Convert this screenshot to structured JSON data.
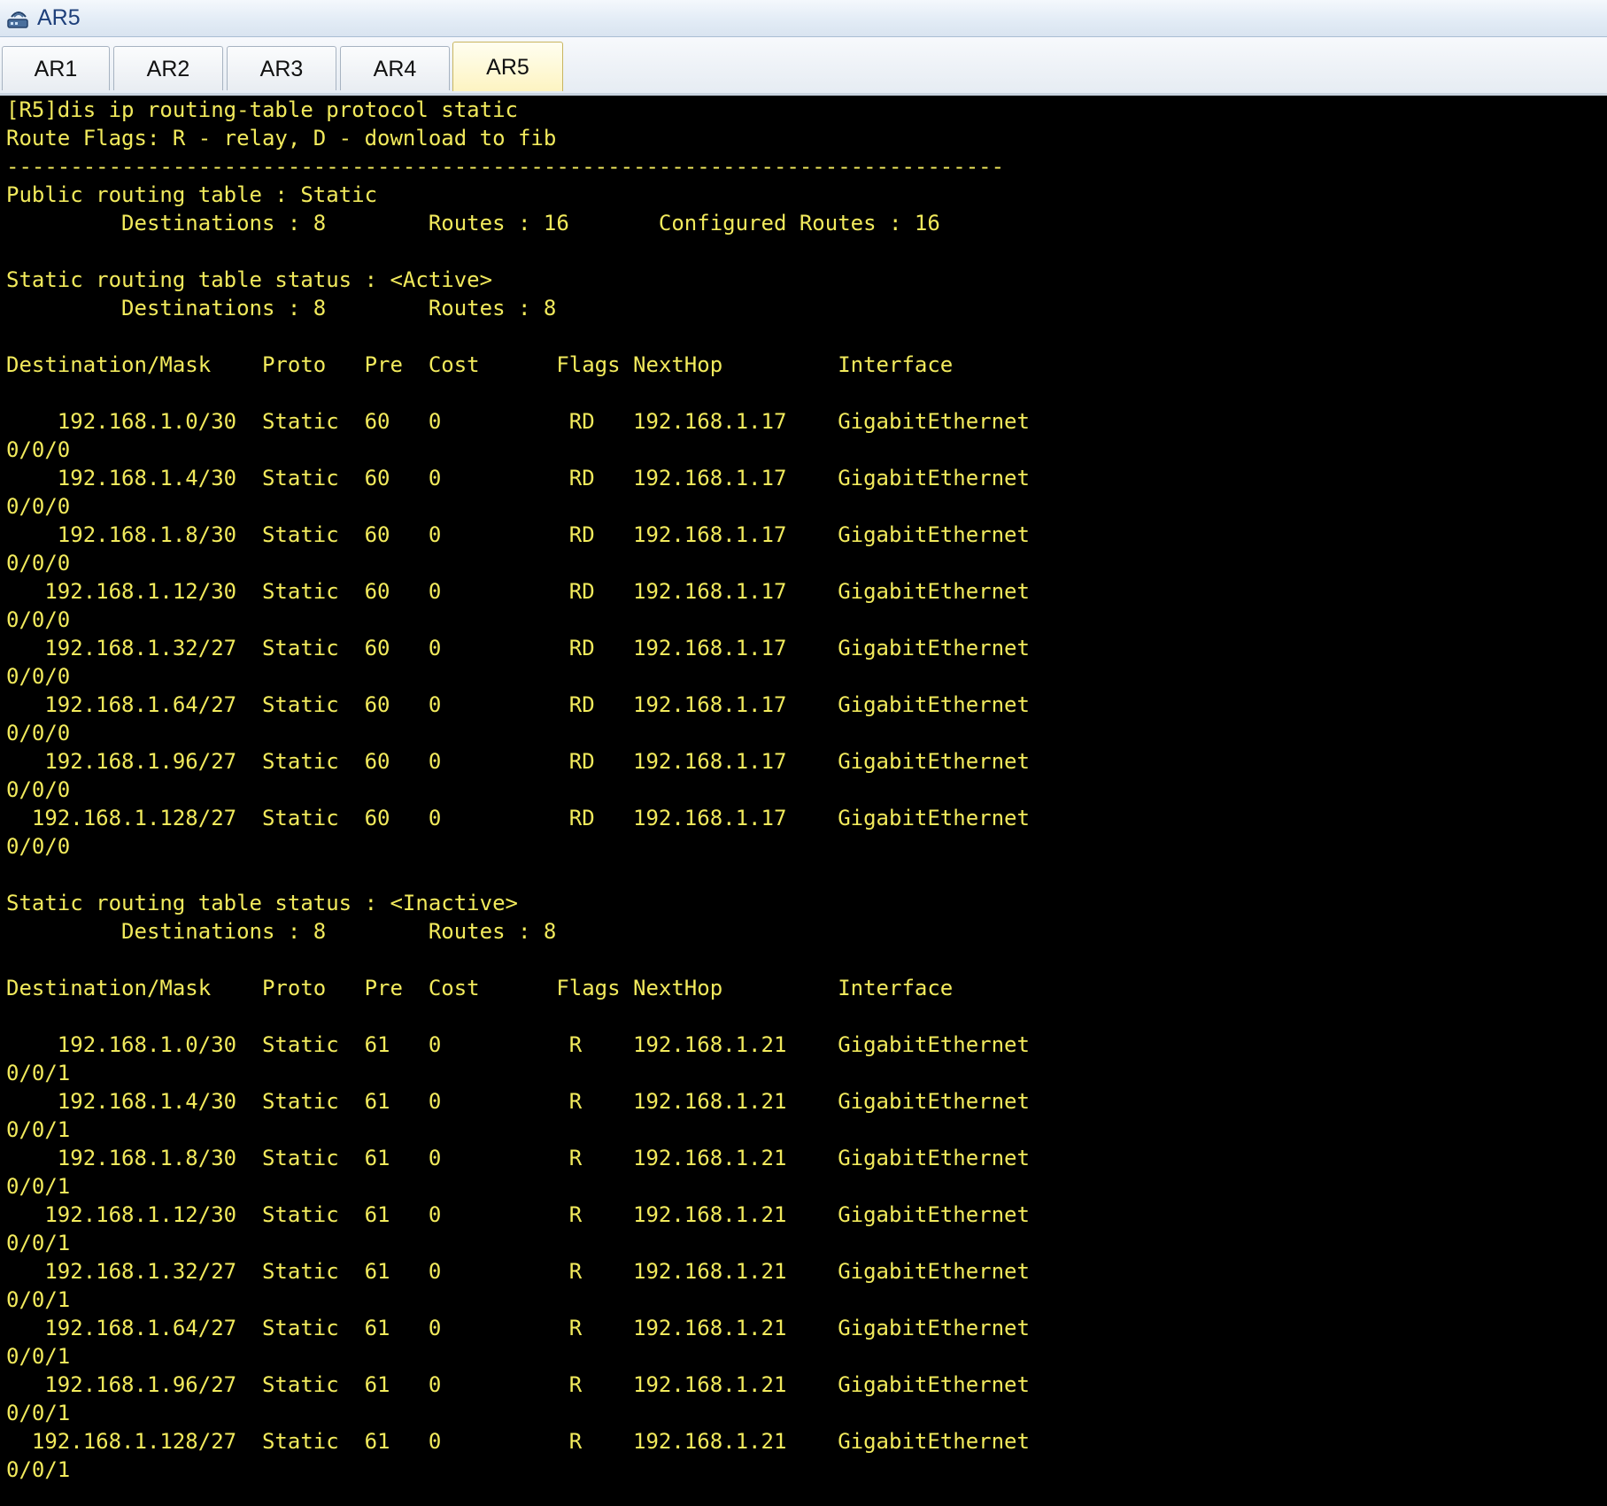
{
  "window": {
    "title": "AR5",
    "icon": "router-app-icon"
  },
  "tabs": [
    {
      "label": "AR1",
      "active": false
    },
    {
      "label": "AR2",
      "active": false
    },
    {
      "label": "AR3",
      "active": false
    },
    {
      "label": "AR4",
      "active": false
    },
    {
      "label": "AR5",
      "active": true
    }
  ],
  "console": {
    "text_color": "#f2ea5c",
    "background_color": "#000000",
    "lines": [
      "[R5]dis ip routing-table protocol static",
      "Route Flags: R - relay, D - download to fib",
      "------------------------------------------------------------------------------",
      "Public routing table : Static",
      "         Destinations : 8        Routes : 16       Configured Routes : 16",
      "",
      "Static routing table status : <Active>",
      "         Destinations : 8        Routes : 8",
      "",
      "Destination/Mask    Proto   Pre  Cost      Flags NextHop         Interface",
      "",
      "    192.168.1.0/30  Static  60   0          RD   192.168.1.17    GigabitEthernet",
      "0/0/0",
      "    192.168.1.4/30  Static  60   0          RD   192.168.1.17    GigabitEthernet",
      "0/0/0",
      "    192.168.1.8/30  Static  60   0          RD   192.168.1.17    GigabitEthernet",
      "0/0/0",
      "   192.168.1.12/30  Static  60   0          RD   192.168.1.17    GigabitEthernet",
      "0/0/0",
      "   192.168.1.32/27  Static  60   0          RD   192.168.1.17    GigabitEthernet",
      "0/0/0",
      "   192.168.1.64/27  Static  60   0          RD   192.168.1.17    GigabitEthernet",
      "0/0/0",
      "   192.168.1.96/27  Static  60   0          RD   192.168.1.17    GigabitEthernet",
      "0/0/0",
      "  192.168.1.128/27  Static  60   0          RD   192.168.1.17    GigabitEthernet",
      "0/0/0",
      "",
      "Static routing table status : <Inactive>",
      "         Destinations : 8        Routes : 8",
      "",
      "Destination/Mask    Proto   Pre  Cost      Flags NextHop         Interface",
      "",
      "    192.168.1.0/30  Static  61   0          R    192.168.1.21    GigabitEthernet",
      "0/0/1",
      "    192.168.1.4/30  Static  61   0          R    192.168.1.21    GigabitEthernet",
      "0/0/1",
      "    192.168.1.8/30  Static  61   0          R    192.168.1.21    GigabitEthernet",
      "0/0/1",
      "   192.168.1.12/30  Static  61   0          R    192.168.1.21    GigabitEthernet",
      "0/0/1",
      "   192.168.1.32/27  Static  61   0          R    192.168.1.21    GigabitEthernet",
      "0/0/1",
      "   192.168.1.64/27  Static  61   0          R    192.168.1.21    GigabitEthernet",
      "0/0/1",
      "   192.168.1.96/27  Static  61   0          R    192.168.1.21    GigabitEthernet",
      "0/0/1",
      "  192.168.1.128/27  Static  61   0          R    192.168.1.21    GigabitEthernet",
      "0/0/1"
    ]
  }
}
